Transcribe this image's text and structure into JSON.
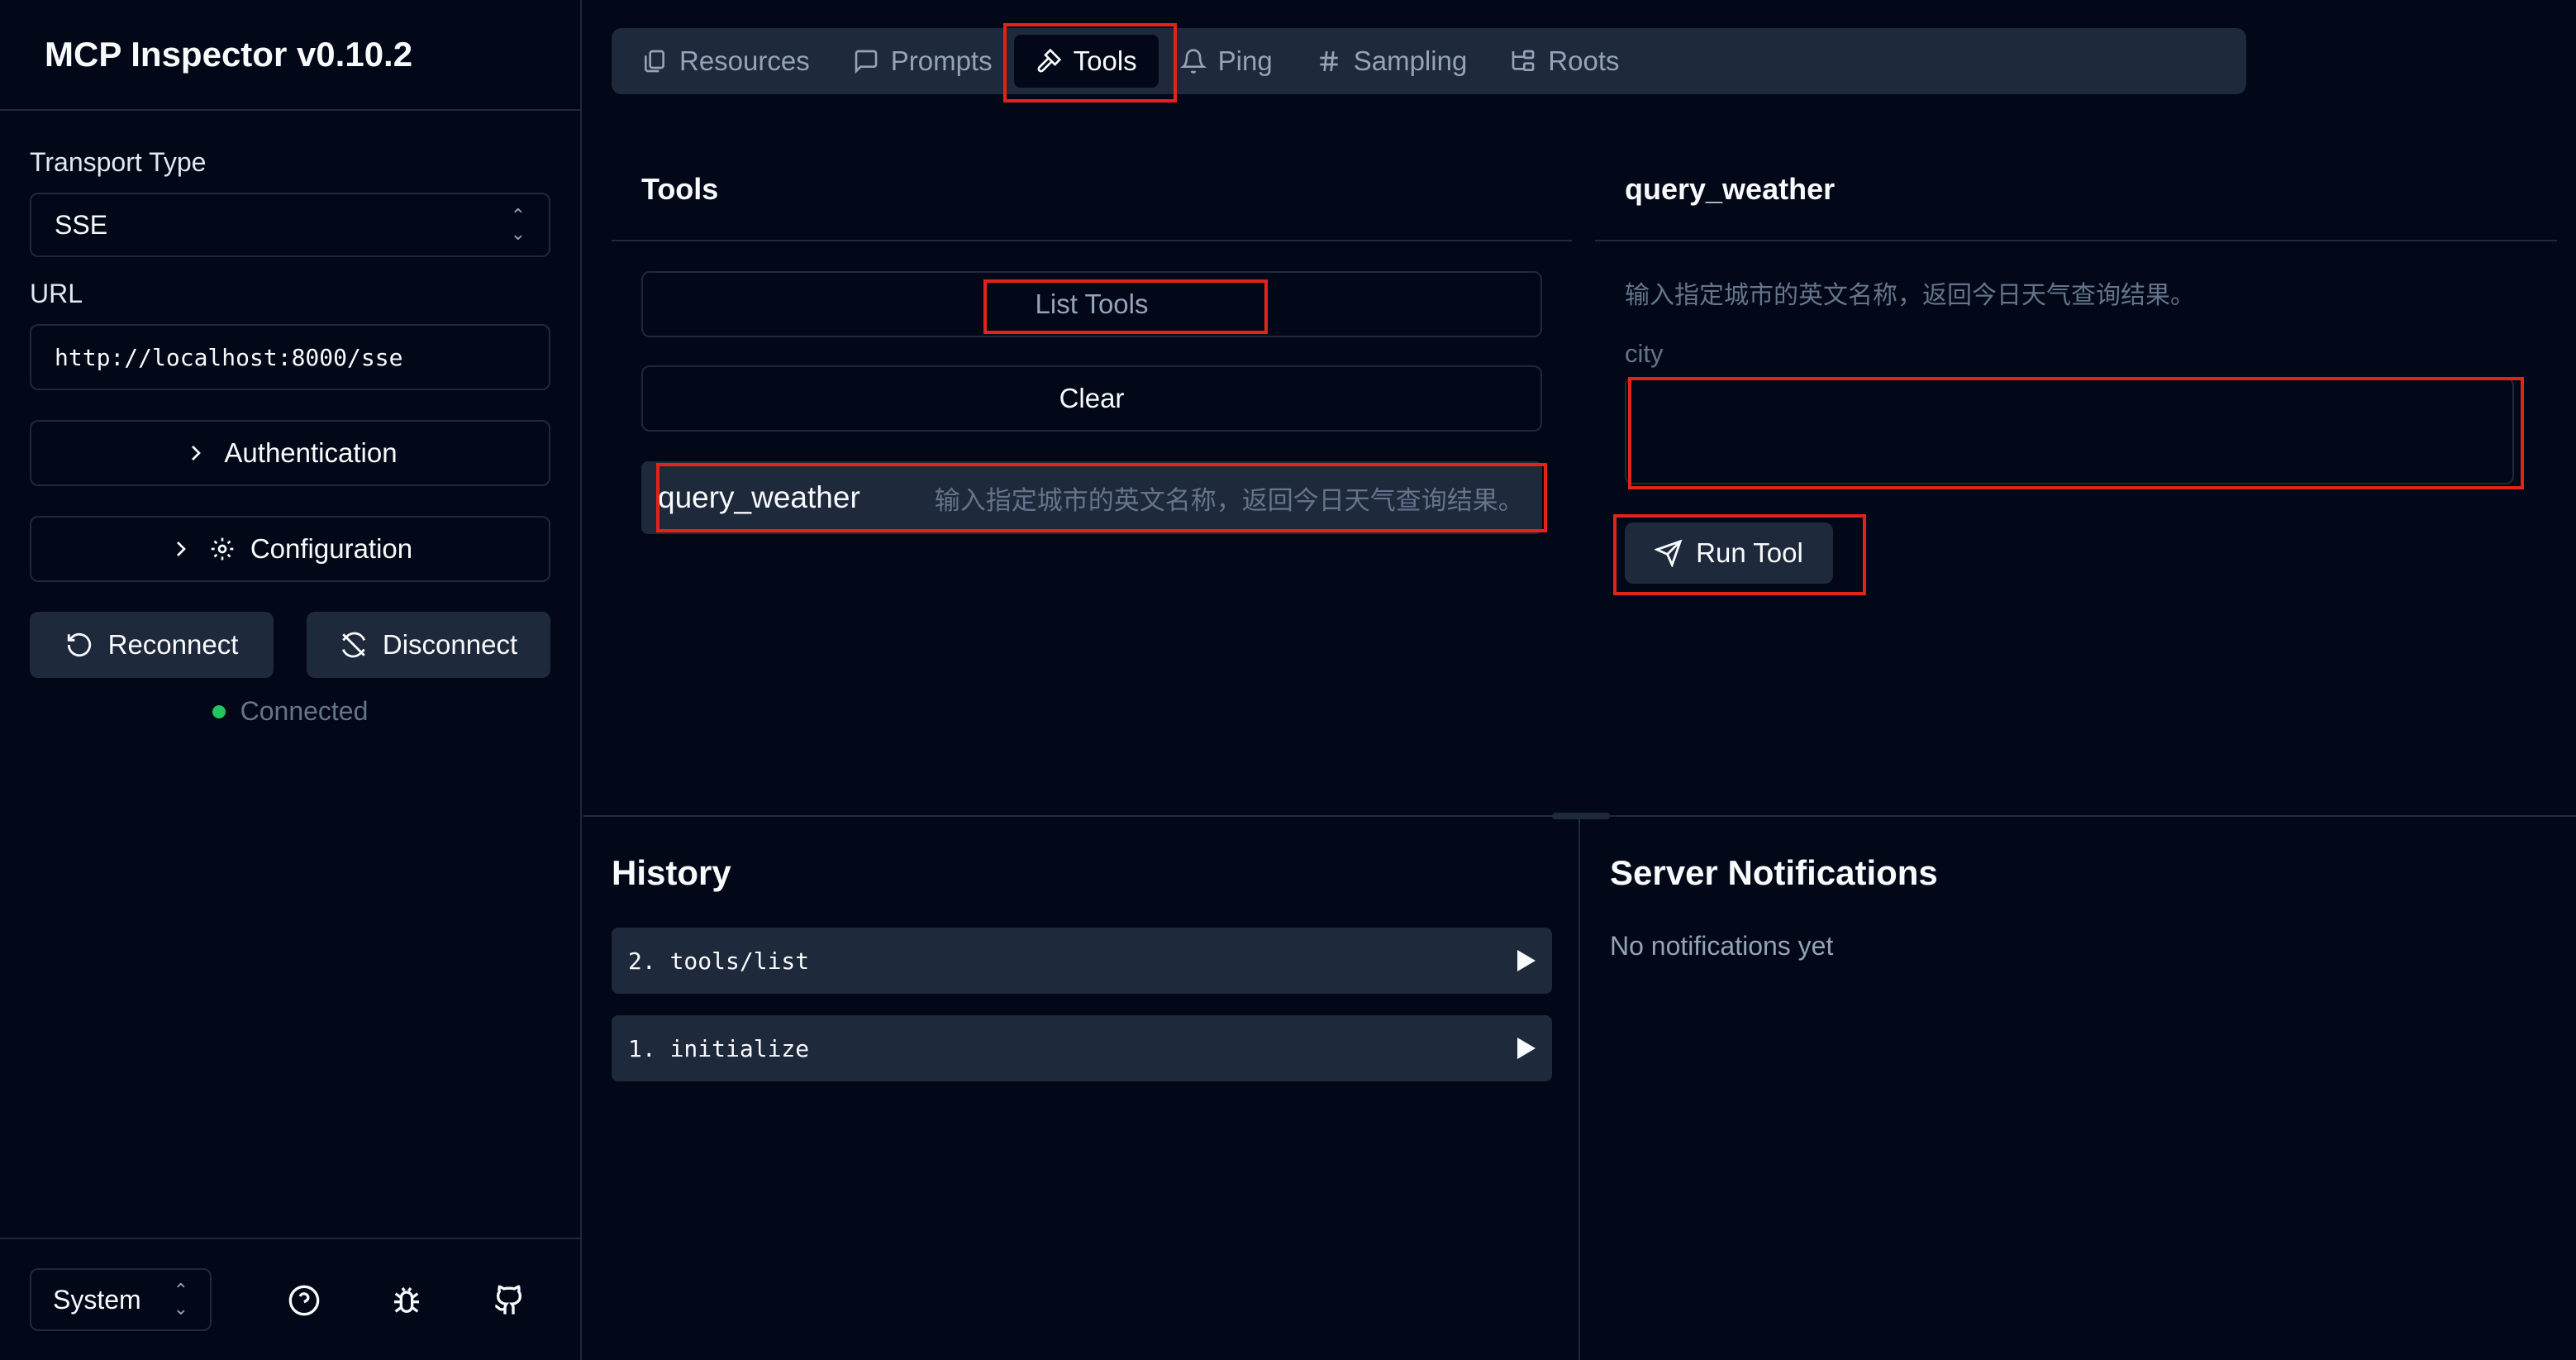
{
  "sidebar": {
    "app_title": "MCP Inspector v0.10.2",
    "transport_label": "Transport Type",
    "transport_value": "SSE",
    "url_label": "URL",
    "url_value": "http://localhost:8000/sse",
    "authentication_label": "Authentication",
    "configuration_label": "Configuration",
    "reconnect_label": "Reconnect",
    "disconnect_label": "Disconnect",
    "status_text": "Connected",
    "status_color": "#22c55e",
    "theme_value": "System"
  },
  "tabs": [
    {
      "label": "Resources",
      "icon": "files-icon"
    },
    {
      "label": "Prompts",
      "icon": "message-square-icon"
    },
    {
      "label": "Tools",
      "icon": "hammer-icon",
      "active": true
    },
    {
      "label": "Ping",
      "icon": "bell-icon"
    },
    {
      "label": "Sampling",
      "icon": "hash-icon"
    },
    {
      "label": "Roots",
      "icon": "folder-tree-icon"
    }
  ],
  "tools_panel": {
    "title": "Tools",
    "list_tools_label": "List Tools",
    "clear_label": "Clear",
    "tools": [
      {
        "name": "query_weather",
        "description": "输入指定城市的英文名称，返回今日天气查询结果。"
      }
    ]
  },
  "tool_detail": {
    "title": "query_weather",
    "description": "输入指定城市的英文名称，返回今日天气查询结果。",
    "param_label": "city",
    "param_value": "",
    "run_label": "Run Tool"
  },
  "history": {
    "title": "History",
    "items": [
      {
        "label": "2. tools/list"
      },
      {
        "label": "1. initialize"
      }
    ]
  },
  "notifications": {
    "title": "Server Notifications",
    "empty_text": "No notifications yet"
  },
  "colors": {
    "background": "#020817",
    "border": "#1e293b",
    "highlight": "#e2231a"
  }
}
